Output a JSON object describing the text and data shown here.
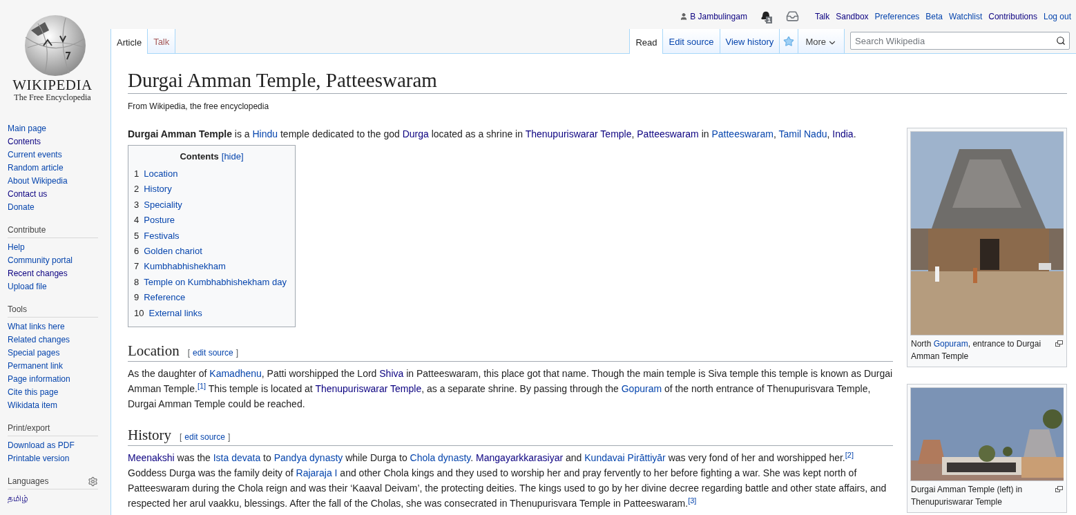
{
  "logo": {
    "wordmark": "WIKIPEDIA",
    "tagline": "The Free Encyclopedia"
  },
  "personal": {
    "user": "B Jambulingam",
    "notification_count": "1",
    "links": [
      {
        "label": "Talk",
        "visited": true
      },
      {
        "label": "Sandbox",
        "visited": true
      },
      {
        "label": "Preferences",
        "visited": false
      },
      {
        "label": "Beta",
        "visited": false
      },
      {
        "label": "Watchlist",
        "visited": false
      },
      {
        "label": "Contributions",
        "visited": true
      },
      {
        "label": "Log out",
        "visited": false
      }
    ]
  },
  "left_tabs": [
    {
      "label": "Article",
      "selected": true
    },
    {
      "label": "Talk",
      "selected": false
    }
  ],
  "right_tabs": [
    {
      "kind": "tab",
      "label": "Read",
      "selected": true
    },
    {
      "kind": "tab",
      "label": "Edit source",
      "selected": false
    },
    {
      "kind": "tab",
      "label": "View history",
      "selected": false
    },
    {
      "kind": "star",
      "selected": false
    },
    {
      "kind": "menu",
      "label": "More",
      "selected": false
    }
  ],
  "search": {
    "placeholder": "Search Wikipedia"
  },
  "sidebar": {
    "sections": [
      {
        "items": [
          {
            "label": "Main page",
            "visited": false
          },
          {
            "label": "Contents",
            "visited": true
          },
          {
            "label": "Current events",
            "visited": false
          },
          {
            "label": "Random article",
            "visited": false
          },
          {
            "label": "About Wikipedia",
            "visited": false
          },
          {
            "label": "Contact us",
            "visited": true
          },
          {
            "label": "Donate",
            "visited": false
          }
        ]
      },
      {
        "heading": "Contribute",
        "items": [
          {
            "label": "Help",
            "visited": false
          },
          {
            "label": "Community portal",
            "visited": false
          },
          {
            "label": "Recent changes",
            "visited": true
          },
          {
            "label": "Upload file",
            "visited": false
          }
        ]
      },
      {
        "heading": "Tools",
        "items": [
          {
            "label": "What links here",
            "visited": false
          },
          {
            "label": "Related changes",
            "visited": false
          },
          {
            "label": "Special pages",
            "visited": false
          },
          {
            "label": "Permanent link",
            "visited": false
          },
          {
            "label": "Page information",
            "visited": false
          },
          {
            "label": "Cite this page",
            "visited": false
          },
          {
            "label": "Wikidata item",
            "visited": false
          }
        ]
      },
      {
        "heading": "Print/export",
        "items": [
          {
            "label": "Download as PDF",
            "visited": false
          },
          {
            "label": "Printable version",
            "visited": false
          }
        ]
      },
      {
        "heading": "Languages",
        "has_settings": true,
        "items": [
          {
            "label": "தமிழ்",
            "visited": true
          }
        ]
      }
    ]
  },
  "article": {
    "title": "Durgai Amman Temple, Patteeswaram",
    "tagline": "From Wikipedia, the free encyclopedia",
    "intro": [
      {
        "kind": "bold",
        "text": "Durgai Amman Temple"
      },
      {
        "kind": "plain",
        "text": " is a "
      },
      {
        "kind": "link",
        "text": "Hindu"
      },
      {
        "kind": "plain",
        "text": " temple dedicated to the god "
      },
      {
        "kind": "visited",
        "text": "Durga"
      },
      {
        "kind": "plain",
        "text": " located as a shrine in "
      },
      {
        "kind": "visited",
        "text": "Thenupuriswarar Temple"
      },
      {
        "kind": "plain",
        "text": ", "
      },
      {
        "kind": "visited",
        "text": "Patteeswaram"
      },
      {
        "kind": "plain",
        "text": " in "
      },
      {
        "kind": "link",
        "text": "Patteeswaram"
      },
      {
        "kind": "plain",
        "text": ", "
      },
      {
        "kind": "link",
        "text": "Tamil Nadu"
      },
      {
        "kind": "plain",
        "text": ", "
      },
      {
        "kind": "visited",
        "text": "India"
      },
      {
        "kind": "plain",
        "text": "."
      }
    ],
    "toc": {
      "title": "Contents",
      "toggle": "[hide]",
      "items": [
        {
          "number": "1",
          "label": "Location"
        },
        {
          "number": "2",
          "label": "History"
        },
        {
          "number": "3",
          "label": "Speciality"
        },
        {
          "number": "4",
          "label": "Posture"
        },
        {
          "number": "5",
          "label": "Festivals"
        },
        {
          "number": "6",
          "label": "Golden chariot"
        },
        {
          "number": "7",
          "label": "Kumbhabhishekham"
        },
        {
          "number": "8",
          "label": "Temple on Kumbhabhishekham day"
        },
        {
          "number": "9",
          "label": "Reference"
        },
        {
          "number": "10",
          "label": "External links"
        }
      ]
    },
    "sections": [
      {
        "heading": "Location",
        "edit_open": "[",
        "edit_link": "edit source",
        "edit_close": "]",
        "paragraph": [
          {
            "kind": "plain",
            "text": "As the daughter of "
          },
          {
            "kind": "link",
            "text": "Kamadhenu"
          },
          {
            "kind": "plain",
            "text": ", Patti worshipped the Lord "
          },
          {
            "kind": "visited",
            "text": "Shiva"
          },
          {
            "kind": "plain",
            "text": " in Patteeswaram, this place got that name. Though the main temple is Siva temple this temple is known as Durgai Amman Temple."
          },
          {
            "kind": "ref",
            "text": "[1]"
          },
          {
            "kind": "plain",
            "text": " This temple is located at "
          },
          {
            "kind": "visited",
            "text": "Thenupuriswarar Temple"
          },
          {
            "kind": "plain",
            "text": ", as a separate shrine. By passing through the "
          },
          {
            "kind": "link",
            "text": "Gopuram"
          },
          {
            "kind": "plain",
            "text": " of the north entrance of Thenupurisvara Temple, Durgai Amman Temple could be reached."
          }
        ]
      },
      {
        "heading": "History",
        "edit_open": "[",
        "edit_link": "edit source",
        "edit_close": "]",
        "paragraph": [
          {
            "kind": "visited",
            "text": "Meenakshi"
          },
          {
            "kind": "plain",
            "text": " was the "
          },
          {
            "kind": "link",
            "text": "Ista devata"
          },
          {
            "kind": "plain",
            "text": " to "
          },
          {
            "kind": "link",
            "text": "Pandya dynasty"
          },
          {
            "kind": "plain",
            "text": " while Durga to "
          },
          {
            "kind": "link",
            "text": "Chola dynasty"
          },
          {
            "kind": "plain",
            "text": ". "
          },
          {
            "kind": "visited",
            "text": "Mangayarkkarasiyar"
          },
          {
            "kind": "plain",
            "text": " and "
          },
          {
            "kind": "link",
            "text": "Kundavai Pirāttiyār"
          },
          {
            "kind": "plain",
            "text": " was very fond of her and worshipped her."
          },
          {
            "kind": "ref",
            "text": "[2]"
          },
          {
            "kind": "plain",
            "text": " Goddess Durga was the family deity of "
          },
          {
            "kind": "link",
            "text": "Rajaraja I"
          },
          {
            "kind": "plain",
            "text": " and other Chola kings and they used to worship her and pray fervently to her before fighting a war. She was kept north of Patteeswaram during the Chola reign and was their ‘Kaaval Deivam’, the protecting deities. The kings used to go by her divine decree regarding battle and other state affairs, and respected her arul vaakku, blessings. After the fall of the Cholas, she was consecrated in Thenupurisvara Temple in Patteeswaram."
          },
          {
            "kind": "ref",
            "text": "[3]"
          }
        ]
      }
    ],
    "figures": [
      {
        "kind": "picture",
        "caption": [
          {
            "kind": "plain",
            "text": "North "
          },
          {
            "kind": "link",
            "text": "Gopuram"
          },
          {
            "kind": "plain",
            "text": ", entrance to Durgai Amman Temple"
          }
        ]
      },
      {
        "kind": "picture",
        "caption": [
          {
            "kind": "plain",
            "text": "Durgai Amman Temple (left) in Thenupuriswarar Temple"
          }
        ]
      }
    ]
  }
}
